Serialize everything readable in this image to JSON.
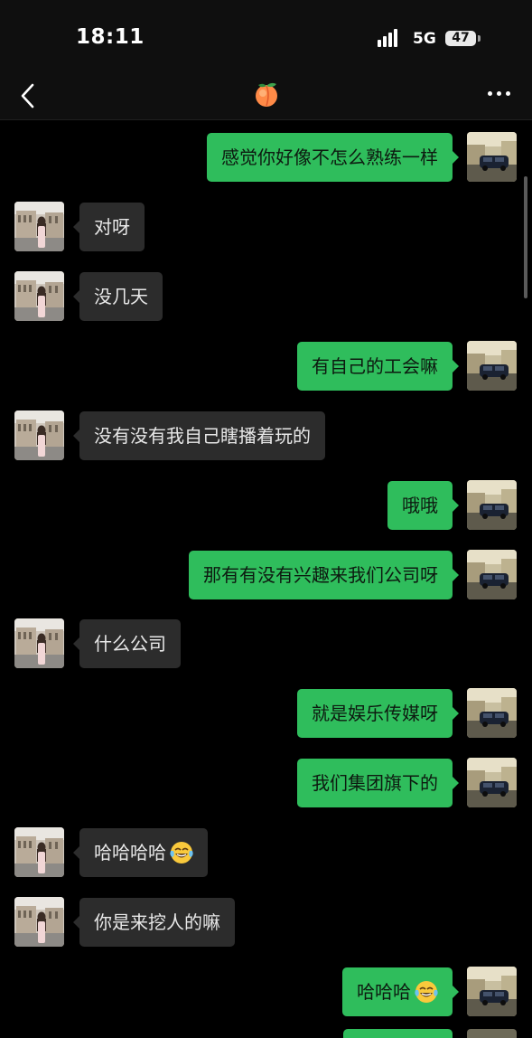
{
  "status": {
    "time": "18:11",
    "network": "5G",
    "battery": "47"
  },
  "header": {
    "title_icon": "peach-emoji-icon",
    "back_icon": "back-arrow-icon",
    "more_icon": "more-options-icon"
  },
  "colors": {
    "background": "#000000",
    "outgoing_bubble": "#2fbd5c",
    "incoming_bubble": "#2c2c2c"
  },
  "messages": [
    {
      "from": "me",
      "text": "感觉你好像不怎么熟练一样"
    },
    {
      "from": "them",
      "text": "对呀"
    },
    {
      "from": "them",
      "text": "没几天"
    },
    {
      "from": "me",
      "text": "有自己的工会嘛"
    },
    {
      "from": "them",
      "text": "没有没有我自己瞎播着玩的"
    },
    {
      "from": "me",
      "text": "哦哦"
    },
    {
      "from": "me",
      "text": "那有有没有兴趣来我们公司呀"
    },
    {
      "from": "them",
      "text": "什么公司"
    },
    {
      "from": "me",
      "text": "就是娱乐传媒呀"
    },
    {
      "from": "me",
      "text": "我们集团旗下的"
    },
    {
      "from": "them",
      "text": "哈哈哈哈",
      "emoji": "tears-of-joy-emoji-icon"
    },
    {
      "from": "them",
      "text": "你是来挖人的嘛"
    },
    {
      "from": "me",
      "text": "哈哈哈",
      "emoji": "tears-of-joy-emoji-icon"
    }
  ]
}
